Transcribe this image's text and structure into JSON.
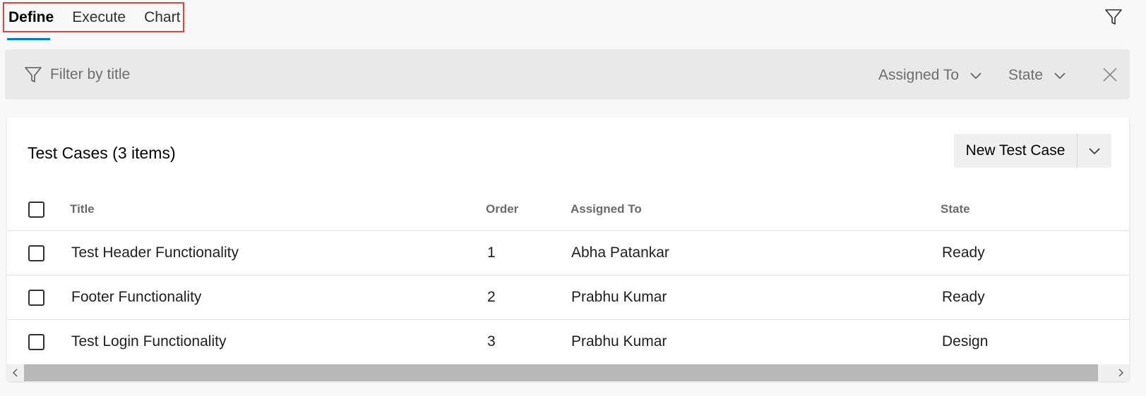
{
  "tabs": [
    {
      "label": "Define"
    },
    {
      "label": "Execute"
    },
    {
      "label": "Chart"
    }
  ],
  "filter": {
    "placeholder": "Filter by title",
    "assigned_to_label": "Assigned To",
    "state_label": "State"
  },
  "card": {
    "title": "Test Cases (3 items)",
    "new_button_label": "New Test Case"
  },
  "table": {
    "columns": [
      "Title",
      "Order",
      "Assigned To",
      "State"
    ],
    "rows": [
      {
        "title": "Test Header Functionality",
        "order": "1",
        "assigned_to": "Abha Patankar",
        "state": "Ready"
      },
      {
        "title": "Footer Functionality",
        "order": "2",
        "assigned_to": "Prabhu Kumar",
        "state": "Ready"
      },
      {
        "title": "Test Login Functionality",
        "order": "3",
        "assigned_to": "Prabhu Kumar",
        "state": "Design"
      }
    ]
  },
  "colors": {
    "accent": "#0078d4",
    "highlight_box": "#e0453d"
  },
  "icons": [
    "filter-icon",
    "chevron-down-icon",
    "close-icon",
    "chevron-left-icon",
    "chevron-right-icon"
  ]
}
